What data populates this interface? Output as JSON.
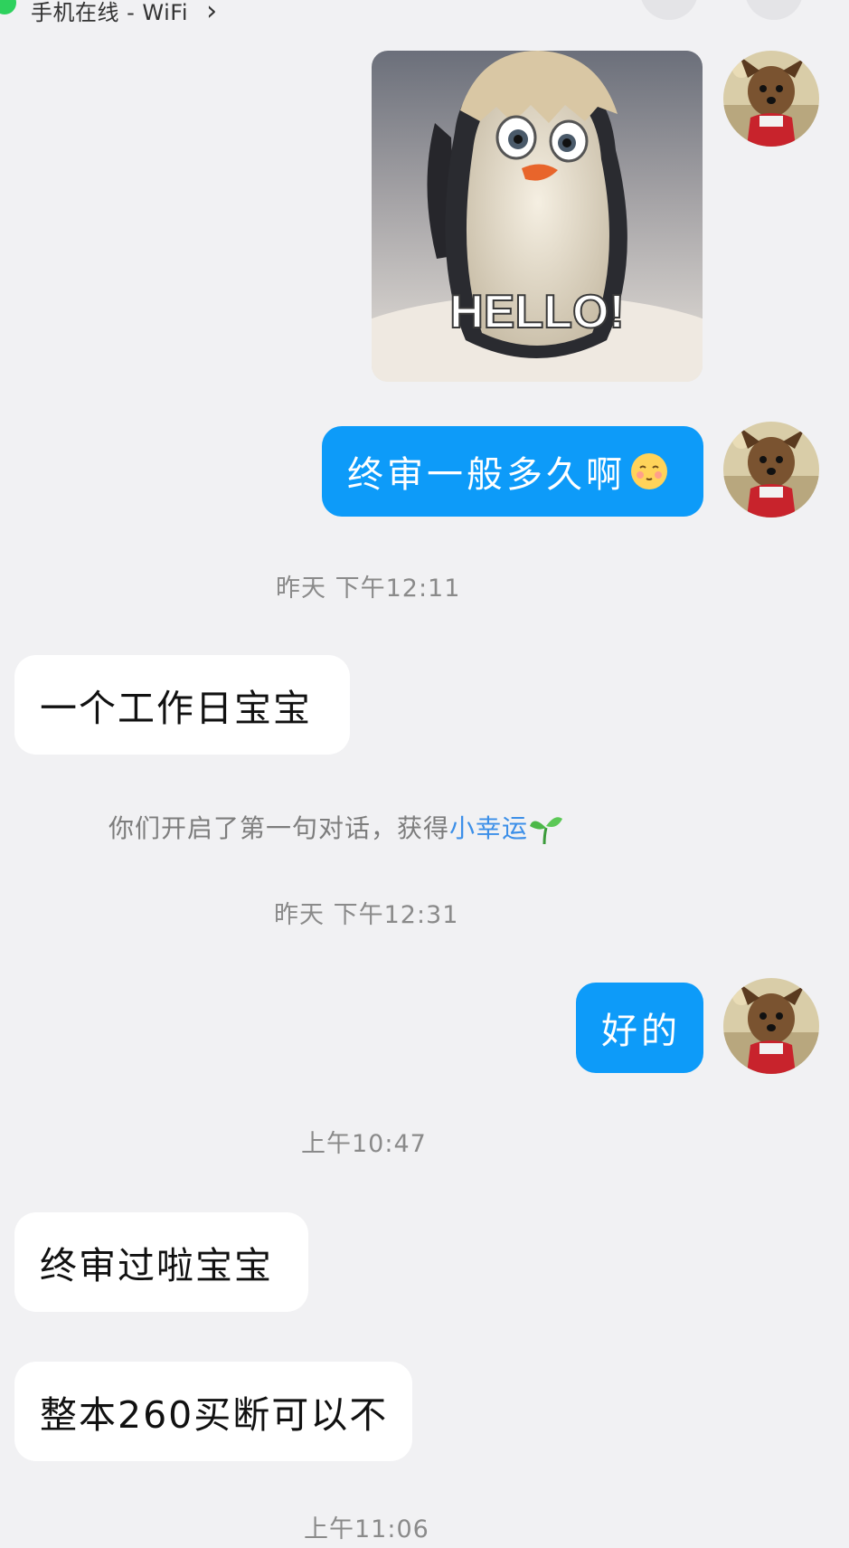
{
  "header": {
    "status_text": "手机在线 - WiFi",
    "status_arrow": "›",
    "online_color": "#2ed15d"
  },
  "colors": {
    "background": "#f1f1f3",
    "my_bubble": "#0d9bf9",
    "their_bubble": "#ffffff",
    "link": "#3c8fe8"
  },
  "messages": [
    {
      "sender": "me",
      "type": "sticker",
      "caption": "HELLO!",
      "sticker_name": "penguin-hello-sticker"
    },
    {
      "sender": "me",
      "type": "text",
      "text": "终审一般多久啊",
      "trailing_icon": "shy-face-emoji"
    },
    {
      "type": "timestamp",
      "text": "昨天 下午12:11"
    },
    {
      "sender": "them",
      "type": "text",
      "text": "一个工作日宝宝"
    },
    {
      "type": "notice",
      "text_before": "你们开启了第一句对话，获得",
      "link_text": "小幸运",
      "icon": "sprout-icon"
    },
    {
      "type": "timestamp",
      "text": "昨天 下午12:31"
    },
    {
      "sender": "me",
      "type": "text",
      "text": "好的"
    },
    {
      "type": "timestamp",
      "text": "上午10:47"
    },
    {
      "sender": "them",
      "type": "text",
      "text": "终审过啦宝宝"
    },
    {
      "sender": "them",
      "type": "text",
      "text": "整本260买断可以不"
    },
    {
      "type": "timestamp",
      "text": "上午11:06"
    }
  ],
  "avatar": {
    "icon": "dog-avatar"
  }
}
